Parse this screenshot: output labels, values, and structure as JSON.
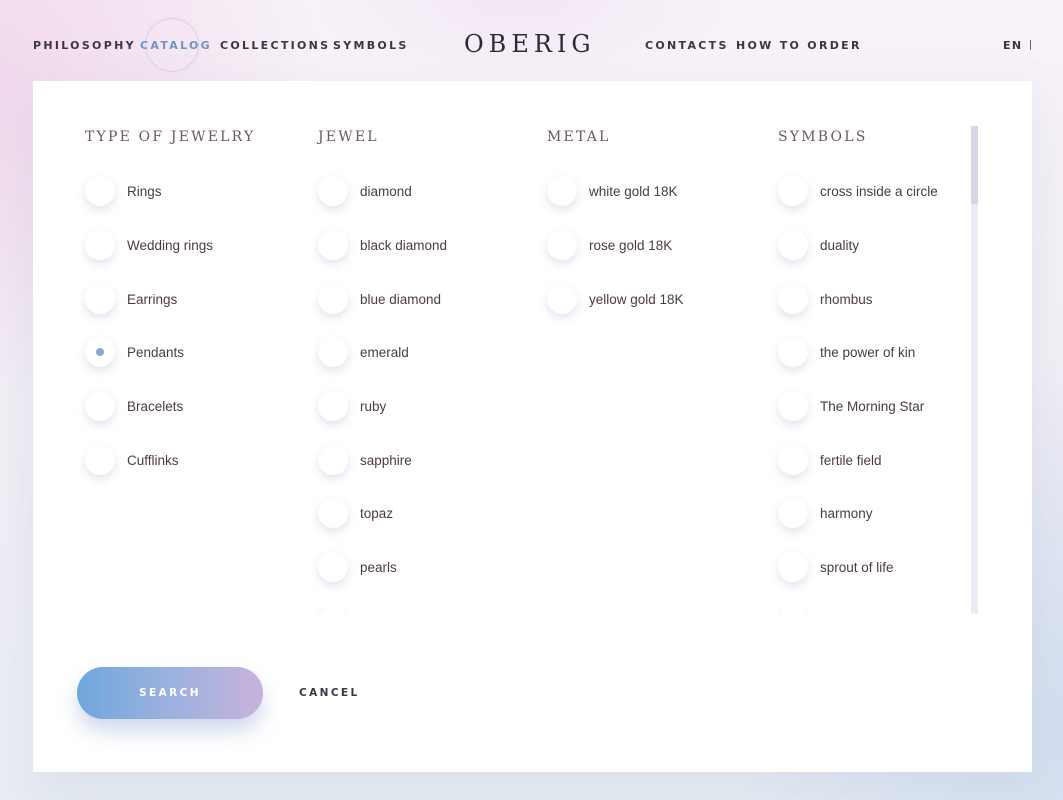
{
  "nav": {
    "left": [
      {
        "id": "philosophy",
        "label": "PHILOSOPHY"
      },
      {
        "id": "catalog",
        "label": "CATALOG"
      },
      {
        "id": "collections",
        "label": "COLLECTIONS"
      },
      {
        "id": "symbols",
        "label": "SYMBOLS"
      }
    ],
    "logo": "OBERIG",
    "right": [
      {
        "id": "contacts",
        "label": "CONTACTS"
      },
      {
        "id": "how-to-order",
        "label": "HOW TO ORDER"
      }
    ],
    "lang": "EN",
    "active": "catalog"
  },
  "filters": {
    "type": {
      "title": "TYPE OF JEWELRY",
      "options": [
        "Rings",
        "Wedding rings",
        "Earrings",
        "Pendants",
        "Bracelets",
        "Cufflinks"
      ],
      "selected": "Pendants"
    },
    "jewel": {
      "title": "JEWEL",
      "options": [
        "diamond",
        "black diamond",
        "blue diamond",
        "emerald",
        "ruby",
        "sapphire",
        "topaz",
        "pearls"
      ]
    },
    "metal": {
      "title": "METAL",
      "options": [
        "white gold 18K",
        "rose gold 18K",
        "yellow gold 18K"
      ]
    },
    "symbols": {
      "title": "SYMBOLS",
      "options": [
        "cross inside a circle",
        "duality",
        "rhombus",
        "the power of kin",
        "The Morning Star",
        "fertile field",
        "harmony",
        "sprout of life"
      ]
    }
  },
  "actions": {
    "search": "SEARCH",
    "cancel": "CANCEL"
  },
  "colors": {
    "accent": "#6f93c2",
    "selected_dot": "#8ea5d3"
  }
}
